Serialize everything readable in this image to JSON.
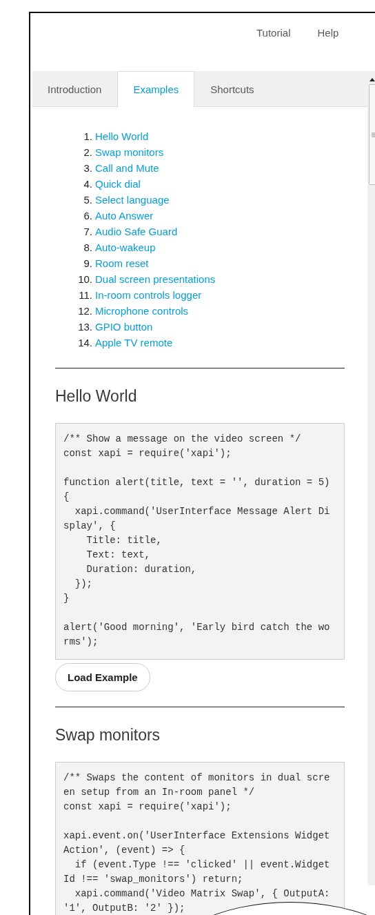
{
  "header": {
    "links": [
      "Tutorial",
      "Help"
    ]
  },
  "tabs": [
    {
      "label": "Introduction",
      "selected": false
    },
    {
      "label": "Examples",
      "selected": true
    },
    {
      "label": "Shortcuts",
      "selected": false
    }
  ],
  "examples_index": [
    {
      "number": "1.",
      "title": "Hello World"
    },
    {
      "number": "2.",
      "title": "Swap monitors"
    },
    {
      "number": "3.",
      "title": "Call and Mute"
    },
    {
      "number": "4.",
      "title": "Quick dial"
    },
    {
      "number": "5.",
      "title": "Select language"
    },
    {
      "number": "6.",
      "title": "Auto Answer"
    },
    {
      "number": "7.",
      "title": "Audio Safe Guard"
    },
    {
      "number": "8.",
      "title": "Auto-wakeup"
    },
    {
      "number": "9.",
      "title": "Room reset"
    },
    {
      "number": "10.",
      "title": "Dual screen presentations"
    },
    {
      "number": "11.",
      "title": "In-room controls logger"
    },
    {
      "number": "12.",
      "title": "Microphone controls"
    },
    {
      "number": "13.",
      "title": "GPIO button"
    },
    {
      "number": "14.",
      "title": "Apple TV remote"
    }
  ],
  "examples": [
    {
      "title": "Hello World",
      "code": "/** Show a message on the video screen */\nconst xapi = require('xapi');\n\nfunction alert(title, text = '', duration = 5)\n{\n  xapi.command('UserInterface Message Alert Di\nsplay', {\n    Title: title,\n    Text: text,\n    Duration: duration,\n  });\n}\n\nalert('Good morning', 'Early bird catch the wo\nrms');",
      "button": "Load Example"
    },
    {
      "title": "Swap monitors",
      "code": "/** Swaps the content of monitors in dual scre\nen setup from an In-room panel */\nconst xapi = require('xapi');\n\nxapi.event.on('UserInterface Extensions Widget\nAction', (event) => {\n  if (event.Type !== 'clicked' || event.Widget\nId !== 'swap_monitors') return;\n  xapi.command('Video Matrix Swap', { OutputA:\n'1', OutputB: '2' });"
    }
  ]
}
